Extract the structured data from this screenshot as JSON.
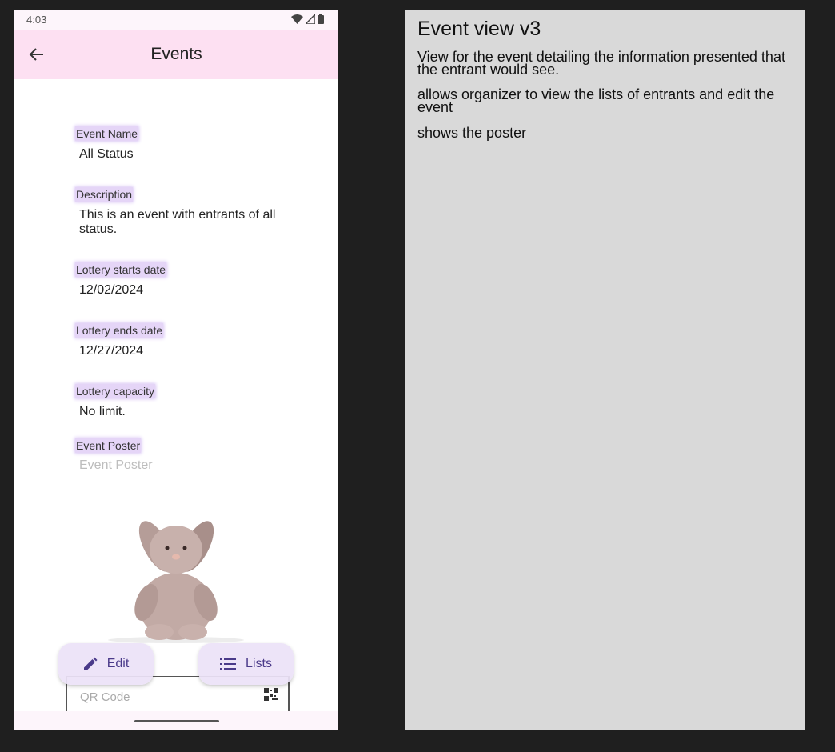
{
  "status_bar": {
    "time": "4:03"
  },
  "app_bar": {
    "title": "Events"
  },
  "fields": {
    "event_name": {
      "label": "Event Name",
      "value": "All Status"
    },
    "description": {
      "label": "Description",
      "value": "This is an event with entrants of all status."
    },
    "lottery_start": {
      "label": "Lottery starts date",
      "value": "12/02/2024"
    },
    "lottery_end": {
      "label": "Lottery ends date",
      "value": "12/27/2024"
    },
    "capacity": {
      "label": "Lottery capacity",
      "value": "No limit."
    },
    "poster": {
      "label": "Event Poster",
      "placeholder": "Event Poster"
    }
  },
  "qr": {
    "placeholder": "QR Code"
  },
  "buttons": {
    "edit": "Edit",
    "lists": "Lists"
  },
  "notes": {
    "title": "Event view v3",
    "items": [
      "View for the event detailing the information presented that the entrant would see.",
      "allows organizer to view the lists of entrants and edit the event",
      "shows the poster"
    ]
  },
  "colors": {
    "app_bar": "#fde0f2",
    "label_highlight": "#e5d5f7",
    "fab": "#ece2f8",
    "notes_panel": "#d9d9d9",
    "background": "#1f1f1f"
  },
  "icons": [
    "back-arrow-icon",
    "wifi-icon",
    "cellular-icon",
    "battery-icon",
    "pencil-icon",
    "list-icon",
    "qr-code-icon"
  ]
}
